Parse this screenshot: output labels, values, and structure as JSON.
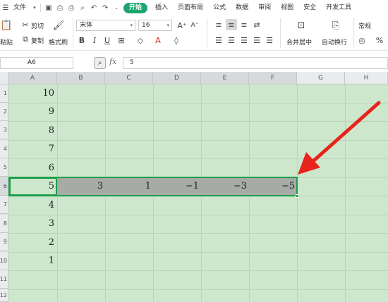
{
  "menu": {
    "file": "文件",
    "tabs": [
      "开始",
      "插入",
      "页面布局",
      "公式",
      "数据",
      "审阅",
      "视图",
      "安全",
      "开发工具"
    ]
  },
  "ribbon": {
    "paste": "粘贴",
    "cut": "剪切",
    "copy": "复制",
    "format_painter": "格式刷",
    "font_name": "宋体",
    "font_size": "16",
    "merge_center": "合并居中",
    "wrap_text": "自动换行",
    "number_format": "常规",
    "percent": "%"
  },
  "formula_bar": {
    "name_box": "A6",
    "fx": "fx",
    "value": "5"
  },
  "columns": [
    "A",
    "B",
    "C",
    "D",
    "E",
    "F",
    "G",
    "H"
  ],
  "rows": [
    "1",
    "2",
    "3",
    "4",
    "5",
    "6",
    "7",
    "8",
    "9",
    "10",
    "11",
    "12"
  ],
  "cells": {
    "A": [
      "10",
      "9",
      "8",
      "7",
      "6",
      "5",
      "4",
      "3",
      "2",
      "1"
    ],
    "row6": [
      "3",
      "1",
      "−1",
      "−3",
      "−5"
    ]
  },
  "colors": {
    "accent": "#1aa56d",
    "sheet_background": "#cde7cc",
    "selection": "#a6aba5",
    "selection_border": "#1e9e4a",
    "arrow": "#e8231c"
  }
}
